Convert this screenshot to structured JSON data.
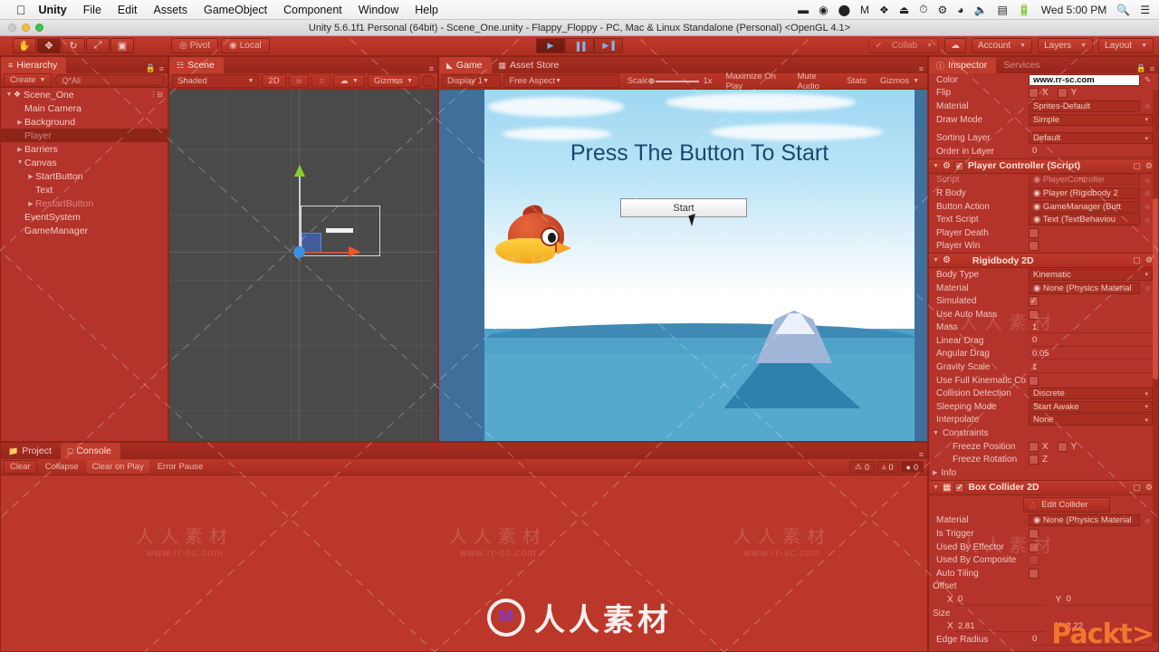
{
  "macbar": {
    "apple_icon": "apple-icon",
    "items": [
      "Unity",
      "File",
      "Edit",
      "Assets",
      "GameObject",
      "Component",
      "Window",
      "Help"
    ],
    "status_icons": [
      "battery-dash-icon",
      "dropbox-ring-icon",
      "location-icon",
      "malwarebytes-icon",
      "dropbox-icon",
      "airplay-icon",
      "timemachine-icon",
      "bluetooth-icon",
      "wifi-icon",
      "volume-icon",
      "input-source-icon",
      "battery-icon"
    ],
    "clock": "Wed 5:00 PM",
    "search_icon": "spotlight-search-icon",
    "notification_icon": "notification-center-icon"
  },
  "window": {
    "title": "Unity 5.6.1f1 Personal (64bit) - Scene_One.unity - Flappy_Floppy - PC, Mac & Linux Standalone (Personal) <OpenGL 4.1>"
  },
  "toolbar": {
    "tools": [
      {
        "name": "hand-tool",
        "glyph": "✋",
        "active": false
      },
      {
        "name": "move-tool",
        "glyph": "✥",
        "active": true
      },
      {
        "name": "rotate-tool",
        "glyph": "↻",
        "active": false
      },
      {
        "name": "scale-tool",
        "glyph": "⤢",
        "active": false
      },
      {
        "name": "rect-tool",
        "glyph": "▣",
        "active": false
      }
    ],
    "pivot_label": "Pivot",
    "local_label": "Local",
    "play_label": "▶",
    "pause_label": "▐▐",
    "step_label": "▶▐",
    "collab_label": "Collab",
    "cloud_icon": "cloud-icon",
    "account_label": "Account",
    "layers_label": "Layers",
    "layout_label": "Layout"
  },
  "hierarchy": {
    "tab_label": "Hierarchy",
    "tab_icon": "hierarchy-icon",
    "create_label": "Create",
    "search_placeholder": "Q*All",
    "items": [
      {
        "label": "Scene_One",
        "depth": 0,
        "arrow": "▼",
        "icon": "unity-scene-icon",
        "selected": false,
        "dim": false,
        "badge": "⋮⊟"
      },
      {
        "label": "Main Camera",
        "depth": 1,
        "arrow": "",
        "icon": "",
        "selected": false,
        "dim": false,
        "badge": ""
      },
      {
        "label": "Background",
        "depth": 1,
        "arrow": "▶",
        "icon": "",
        "selected": false,
        "dim": false,
        "badge": ""
      },
      {
        "label": "Player",
        "depth": 1,
        "arrow": "",
        "icon": "",
        "selected": true,
        "dim": true,
        "badge": ""
      },
      {
        "label": "Barriers",
        "depth": 1,
        "arrow": "▶",
        "icon": "",
        "selected": false,
        "dim": false,
        "badge": ""
      },
      {
        "label": "Canvas",
        "depth": 1,
        "arrow": "▼",
        "icon": "",
        "selected": false,
        "dim": false,
        "badge": ""
      },
      {
        "label": "StartButton",
        "depth": 2,
        "arrow": "▶",
        "icon": "",
        "selected": false,
        "dim": false,
        "badge": ""
      },
      {
        "label": "Text",
        "depth": 2,
        "arrow": "",
        "icon": "",
        "selected": false,
        "dim": false,
        "badge": ""
      },
      {
        "label": "RestartButton",
        "depth": 2,
        "arrow": "▶",
        "icon": "",
        "selected": false,
        "dim": true,
        "badge": ""
      },
      {
        "label": "EventSystem",
        "depth": 1,
        "arrow": "",
        "icon": "",
        "selected": false,
        "dim": false,
        "badge": ""
      },
      {
        "label": "GameManager",
        "depth": 1,
        "arrow": "",
        "icon": "",
        "selected": false,
        "dim": false,
        "badge": ""
      }
    ]
  },
  "scene": {
    "tab_label": "Scene",
    "tab_icon": "scene-icon",
    "shading_label": "Shaded",
    "mode_2d_label": "2D",
    "light_icon": "lighting-icon",
    "audio_icon": "audio-icon",
    "fx_icon": "effects-icon",
    "gizmos_label": "Gizmos",
    "search_placeholder": ""
  },
  "game": {
    "tab_label": "Game",
    "tab_icon": "game-icon",
    "asset_store_tab_label": "Asset Store",
    "asset_store_icon": "asset-store-icon",
    "display_label": "Display 1",
    "aspect_label": "Free Aspect",
    "scale_label": "Scale",
    "scale_value": "1x",
    "maximize_label": "Maximize On Play",
    "mute_label": "Mute Audio",
    "stats_label": "Stats",
    "gizmos_label": "Gizmos",
    "title_text": "Press The Button To Start",
    "start_button_label": "Start"
  },
  "inspector": {
    "tab_label": "Inspector",
    "tab_icon": "inspector-icon",
    "services_tab_label": "Services",
    "sprite_renderer": {
      "color_label": "Color",
      "color_value": "www.rr-sc.com",
      "eyedropper_icon": "eyedropper-icon",
      "flip_label": "Flip",
      "flip_x_label": "X",
      "flip_y_label": "Y",
      "material_label": "Material",
      "material_value": "Sprites-Default",
      "draw_mode_label": "Draw Mode",
      "draw_mode_value": "Simple",
      "sorting_layer_label": "Sorting Layer",
      "sorting_layer_value": "Default",
      "order_label": "Order in Layer",
      "order_value": "0"
    },
    "player_controller": {
      "title": "Player Controller (Script)",
      "icon": "script-icon",
      "enabled": true,
      "rows": [
        {
          "label": "Script",
          "value": "PlayerController",
          "type": "object",
          "dim": true
        },
        {
          "label": "R Body",
          "value": "Player (Rigidbody 2",
          "type": "object",
          "dim": false
        },
        {
          "label": "Button Action",
          "value": "GameManager (Butt",
          "type": "object",
          "dim": false
        },
        {
          "label": "Text Script",
          "value": "Text (TextBehaviou",
          "type": "object",
          "dim": false
        },
        {
          "label": "Player Death",
          "value": "",
          "type": "check",
          "dim": false
        },
        {
          "label": "Player Win",
          "value": "",
          "type": "check",
          "dim": false
        }
      ]
    },
    "rigidbody2d": {
      "title": "Rigidbody 2D",
      "icon": "rigidbody-icon",
      "rows": [
        {
          "label": "Body Type",
          "value": "Kinematic",
          "type": "dropdown"
        },
        {
          "label": "Material",
          "value": "None (Physics Material",
          "type": "object"
        },
        {
          "label": "Simulated",
          "value": "",
          "type": "check-on"
        },
        {
          "label": "Use Auto Mass",
          "value": "",
          "type": "check"
        },
        {
          "label": "Mass",
          "value": "1",
          "type": "text"
        },
        {
          "label": "Linear Drag",
          "value": "0",
          "type": "text"
        },
        {
          "label": "Angular Drag",
          "value": "0.05",
          "type": "text"
        },
        {
          "label": "Gravity Scale",
          "value": "1",
          "type": "text"
        },
        {
          "label": "Use Full Kinematic Co",
          "value": "",
          "type": "check"
        },
        {
          "label": "Collision Detection",
          "value": "Discrete",
          "type": "dropdown"
        },
        {
          "label": "Sleeping Mode",
          "value": "Start Awake",
          "type": "dropdown"
        },
        {
          "label": "Interpolate",
          "value": "None",
          "type": "dropdown"
        }
      ],
      "constraints_label": "Constraints",
      "freeze_position_label": "Freeze Position",
      "freeze_rotation_label": "Freeze Rotation",
      "axis_x": "X",
      "axis_y": "Y",
      "axis_z": "Z",
      "info_label": "Info"
    },
    "box_collider2d": {
      "title": "Box Collider 2D",
      "icon": "collider-icon",
      "enabled": true,
      "edit_collider_label": "Edit Collider",
      "edit_collider_icon": "edit-collider-icon",
      "rows": [
        {
          "label": "Material",
          "value": "None (Physics Material",
          "type": "object"
        },
        {
          "label": "Is Trigger",
          "value": "",
          "type": "check"
        },
        {
          "label": "Used By Effector",
          "value": "",
          "type": "check"
        },
        {
          "label": "Used By Composite",
          "value": "",
          "type": "check-disabled"
        },
        {
          "label": "Auto Tiling",
          "value": "",
          "type": "check"
        }
      ],
      "offset_label": "Offset",
      "offset_x": "0",
      "offset_y": "0",
      "size_label": "Size",
      "size_x": "2.81",
      "size_y": "2.22",
      "edge_radius_label": "Edge Radius",
      "edge_radius_value": "0",
      "axis_x": "X",
      "axis_y": "Y"
    }
  },
  "console": {
    "project_tab_label": "Project",
    "project_tab_icon": "project-icon",
    "console_tab_label": "Console",
    "console_tab_icon": "console-icon",
    "clear_label": "Clear",
    "collapse_label": "Collapse",
    "clear_on_play_label": "Clear on Play",
    "error_pause_label": "Error Pause",
    "error_count": "0",
    "warning_count": "0",
    "log_count": "0"
  },
  "watermarks": {
    "url_top": "www.rr-sc.com",
    "cn_text": "人人素材",
    "cn_short": "素材",
    "url_short": "www.rr-sc.com",
    "packt": "Packt>",
    "logo_letter": "M"
  },
  "colors": {
    "red_overlay": "#b7352a",
    "chrome": "#c2392b",
    "selection": "#8e2318",
    "sky": "#9ed7f2",
    "sea": "#4fa3c9",
    "packt_orange": "#f2762f"
  }
}
